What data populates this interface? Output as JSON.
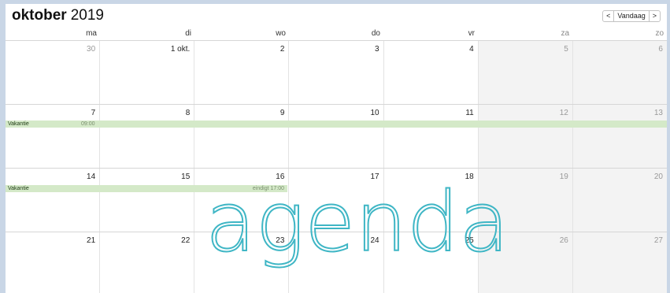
{
  "header": {
    "month": "oktober",
    "year": "2019",
    "prev_label": "<",
    "today_label": "Vandaag",
    "next_label": ">"
  },
  "weekdays": [
    "ma",
    "di",
    "wo",
    "do",
    "vr",
    "za",
    "zo"
  ],
  "weeks": [
    [
      "30",
      "1 okt.",
      "2",
      "3",
      "4",
      "5",
      "6"
    ],
    [
      "7",
      "8",
      "9",
      "10",
      "11",
      "12",
      "13"
    ],
    [
      "14",
      "15",
      "16",
      "17",
      "18",
      "19",
      "20"
    ],
    [
      "21",
      "22",
      "23",
      "24",
      "25",
      "26",
      "27"
    ]
  ],
  "events": [
    {
      "title": "Vakantie",
      "time": "09:00"
    },
    {
      "title": "Vakantie",
      "time": "eindigt 17:00"
    }
  ],
  "overlay": "agenda",
  "colors": {
    "event_bg": "#d4e9c8",
    "weekend_bg": "#f3f3f3",
    "overlay_text": "#3fb6c5"
  }
}
